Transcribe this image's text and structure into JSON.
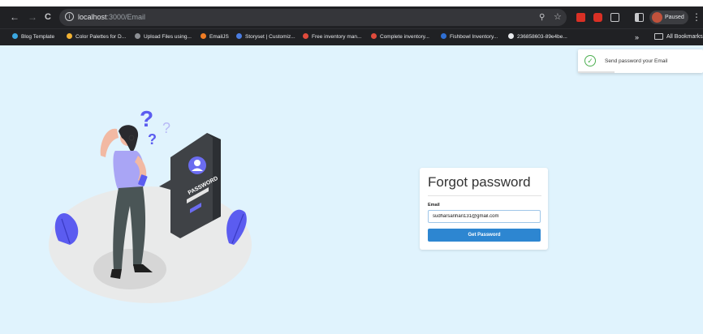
{
  "browser": {
    "nav": {
      "back": "←",
      "forward": "→",
      "reload": "C"
    },
    "url_host": "localhost",
    "url_path": ":3000/Email",
    "profile_status": "Paused",
    "menu": "⋮"
  },
  "bookmarks": {
    "items": [
      {
        "label": "Blog Template",
        "icon_color": "#3ba7e0"
      },
      {
        "label": "Color Palettes for D...",
        "icon_color": "#f2b233"
      },
      {
        "label": "Upload Files using...",
        "icon_color": "#8c8f94"
      },
      {
        "label": "EmailJS",
        "icon_color": "#f07d24"
      },
      {
        "label": "Storyset | Customiz...",
        "icon_color": "#4a7de2"
      },
      {
        "label": "Free inventory man...",
        "icon_color": "#e04b3c"
      },
      {
        "label": "Complete inventory...",
        "icon_color": "#e04b3c"
      },
      {
        "label": "Fishbowl Inventory...",
        "icon_color": "#2f6fd3"
      },
      {
        "label": "236858603-89e4be...",
        "icon_color": "#e8eaed"
      }
    ],
    "overflow": "»",
    "all_bookmarks": "All Bookmarks"
  },
  "toast": {
    "message": "Send password your Email",
    "status": "success",
    "progress": 0.29,
    "color": "#4caf50"
  },
  "form": {
    "title": "Forgot password",
    "email_label": "Email",
    "email_value": "sudharsanhari131@gmail.com",
    "submit_label": "Get Password",
    "button_color": "#2d86d1"
  },
  "illustration": {
    "sign_text": "PASSWORD",
    "question_marks": "?"
  },
  "colors": {
    "page_bg": "#e0f3fd",
    "accent": "#6b6cf0",
    "toolbar": "#202124"
  }
}
